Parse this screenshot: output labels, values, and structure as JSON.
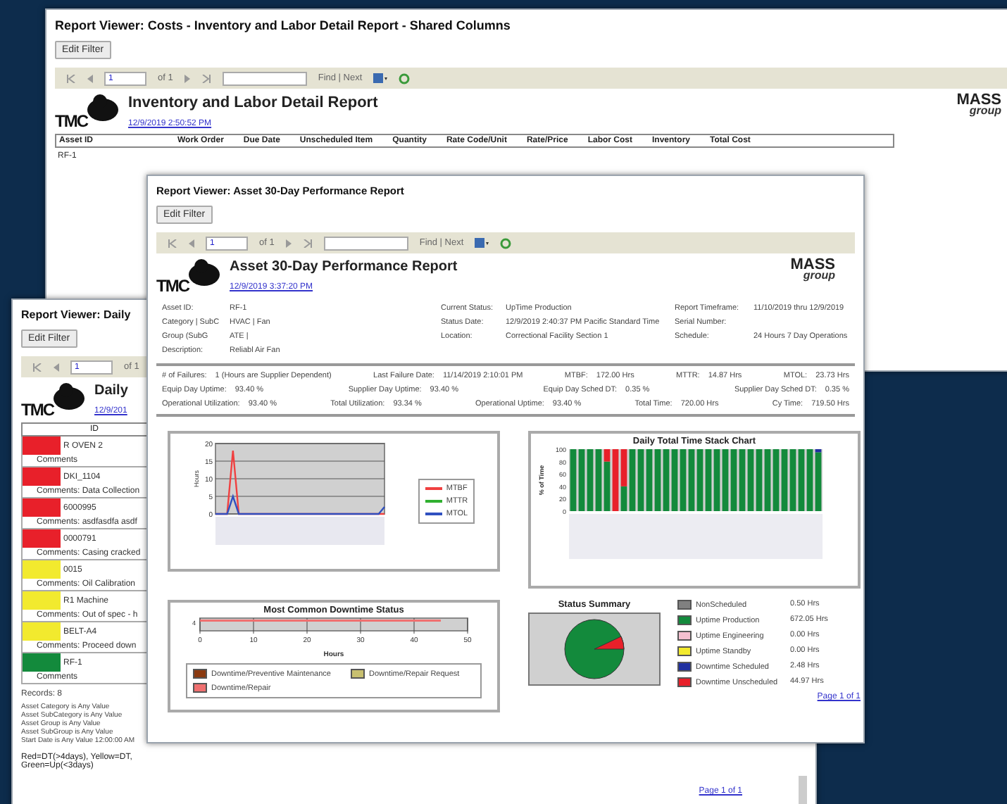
{
  "inventory_window": {
    "title": "Report Viewer: Costs - Inventory and Labor Detail Report - Shared Columns",
    "edit_button": "Edit Filter",
    "toolbar": {
      "page": "1",
      "page_count": "of 1",
      "find_next": "Find | Next"
    },
    "logo": {
      "left": "TMC",
      "right_top": "MASS",
      "right_bottom": "group"
    },
    "report_title": "Inventory and Labor Detail Report",
    "report_date": "12/9/2019 2:50:52 PM",
    "columns": [
      "Asset ID",
      "Work Order",
      "Due Date",
      "Unscheduled Item",
      "Quantity",
      "Rate Code/Unit",
      "Rate/Price",
      "Labor Cost",
      "Inventory",
      "Total Cost"
    ],
    "rows": [
      [
        "RF-1"
      ]
    ]
  },
  "daily_window": {
    "title": "Report Viewer: Daily",
    "edit_button": "Edit Filter",
    "toolbar": {
      "page": "1",
      "page_count": "of 1"
    },
    "logo": {
      "left": "TMC"
    },
    "report_title": "Daily",
    "report_date": "12/9/201",
    "id_header": "ID",
    "rows": [
      {
        "color": "#e8202a",
        "id": "R OVEN 2",
        "comments": "Comments"
      },
      {
        "color": "#e8202a",
        "id": "DKI_1104",
        "comments": "Comments: Data Collection"
      },
      {
        "color": "#e8202a",
        "id": "6000995",
        "comments": "Comments: asdfasdfa asdf"
      },
      {
        "color": "#e8202a",
        "id": "0000791",
        "comments": "Comments: Casing cracked"
      },
      {
        "color": "#f2ea2e",
        "id": "0015",
        "comments": "Comments: Oil Calibration"
      },
      {
        "color": "#f2ea2e",
        "id": "R1 Machine",
        "comments": "Comments: Out of spec - h"
      },
      {
        "color": "#f2ea2e",
        "id": "BELT-A4",
        "comments": "Comments: Proceed down"
      },
      {
        "color": "#138a3c",
        "id": "RF-1",
        "comments": "Comments"
      }
    ],
    "records": "Records: 8",
    "filters": [
      "Asset Category is Any Value",
      "Asset SubCategory is Any Value",
      "Asset Group is Any Value",
      "Asset SubGroup is Any Value",
      "Start Date is Any Value 12:00:00 AM"
    ],
    "legend_note": "Red=DT(>4days), Yellow=DT, Green=Up(<3days)",
    "page_link": "Page 1 of 1"
  },
  "performance_window": {
    "title": "Report Viewer: Asset 30-Day Performance Report",
    "edit_button": "Edit Filter",
    "toolbar": {
      "page": "1",
      "page_count": "of 1",
      "find_next": "Find | Next"
    },
    "logo": {
      "left": "TMC",
      "right_top": "MASS",
      "right_bottom": "group"
    },
    "report_title": "Asset 30-Day Performance Report",
    "report_date": "12/9/2019 3:37:20 PM",
    "info": [
      [
        {
          "label": "Asset ID:",
          "value": "RF-1"
        },
        {
          "label": "Current Status:",
          "value": "UpTime Production"
        },
        {
          "label": "Report Timeframe:",
          "value": "11/10/2019 thru 12/9/2019"
        }
      ],
      [
        {
          "label": "Category | SubC",
          "value": "HVAC | Fan"
        },
        {
          "label": "Status Date:",
          "value": "12/9/2019 2:40:37 PM Pacific Standard Time"
        },
        {
          "label": "Serial Number:"
        }
      ],
      [
        {
          "label": "Group (SubG",
          "value": "ATE |"
        },
        {
          "label": "Location:",
          "value": "Correctional Facility Section 1"
        },
        {
          "label": "Schedule:",
          "value": "24 Hours 7 Day Operations"
        }
      ],
      [
        {
          "label": "Description:",
          "value": "Reliabl Air Fan"
        }
      ]
    ],
    "stats": [
      [
        {
          "label": "# of Failures:",
          "value": "1 (Hours are Supplier Dependent)"
        },
        {
          "label": "Last Failure Date:",
          "value": "11/14/2019 2:10:01 PM"
        },
        {
          "label": "MTBF:",
          "value": "172.00 Hrs"
        },
        {
          "label": "MTTR:",
          "value": "14.87 Hrs"
        },
        {
          "label": "MTOL:",
          "value": "23.73 Hrs"
        }
      ],
      [
        {
          "label": "Equip Day Uptime:",
          "value": "93.40 %"
        },
        {
          "label": "Supplier Day Uptime:",
          "value": "93.40 %"
        },
        {
          "label": "Equip Day Sched DT:",
          "value": "0.35 %"
        },
        {
          "label": "Supplier Day Sched DT:",
          "value": "0.35 %"
        }
      ],
      [
        {
          "label": "Operational Utilization:",
          "value": "93.40 %"
        },
        {
          "label": "Total Utilization:",
          "value": "93.34 %"
        },
        {
          "label": "Operational Uptime:",
          "value": "93.40 %"
        },
        {
          "label": "Total Time:",
          "value": "720.00 Hrs"
        },
        {
          "label": "Cy Time:",
          "value": "719.50 Hrs"
        }
      ]
    ],
    "line_chart": {
      "ylabel": "Hours",
      "y_tick_labels": [
        "20",
        "15",
        "10",
        "5",
        "0"
      ],
      "legend": [
        {
          "name": "MTBF",
          "color": "#f04040"
        },
        {
          "name": "MTTR",
          "color": "#30b030"
        },
        {
          "name": "MTOL",
          "color": "#3050c0"
        }
      ]
    },
    "downtime_chart": {
      "title": "Most Common Downtime Status",
      "category_label": "4",
      "x_tick_labels": [
        "0",
        "10",
        "20",
        "30",
        "40",
        "50"
      ],
      "xlabel": "Hours",
      "legend": [
        {
          "name": "Downtime/Preventive Maintenance",
          "color": "#8b3a10"
        },
        {
          "name": "Downtime/Repair Request",
          "color": "#c8c070"
        },
        {
          "name": "Downtime/Repair",
          "color": "#f07070"
        }
      ]
    },
    "stack_chart": {
      "title": "Daily Total Time Stack Chart",
      "ylabel": "% of Time",
      "y_tick_labels": [
        "100",
        "80",
        "60",
        "40",
        "20",
        "0"
      ]
    },
    "status_summary": {
      "title": "Status Summary",
      "legend": [
        {
          "name": "NonScheduled",
          "value": "0.50 Hrs",
          "color": "#808080"
        },
        {
          "name": "Uptime Production",
          "value": "672.05 Hrs",
          "color": "#138a3c"
        },
        {
          "name": "Uptime Engineering",
          "value": "0.00 Hrs",
          "color": "#f4c0d0"
        },
        {
          "name": "Uptime Standby",
          "value": "0.00 Hrs",
          "color": "#f2ea2e"
        },
        {
          "name": "Downtime Scheduled",
          "value": "2.48 Hrs",
          "color": "#2030a0"
        },
        {
          "name": "Downtime Unscheduled",
          "value": "44.97 Hrs",
          "color": "#e8202a"
        }
      ]
    },
    "page_link": "Page 1 of 1"
  }
}
